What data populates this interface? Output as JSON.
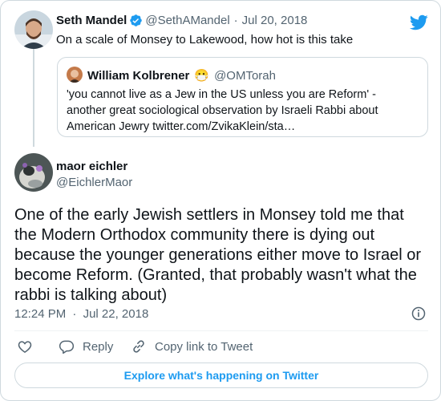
{
  "reply_to": {
    "display_name": "Seth Mandel",
    "handle": "@SethAMandel",
    "separator": "·",
    "date": "Jul 20, 2018",
    "text": "On a scale of Monsey to Lakewood, how hot is this take",
    "verified": true
  },
  "quoted": {
    "display_name": "William Kolbrener",
    "name_emoji": "😷",
    "handle": "@OMTorah",
    "text_lines": [
      "'you cannot live as a Jew in the US unless you are Reform' -",
      "another great sociological observation by Israeli Rabbi about",
      "American Jewry twitter.com/ZvikaKlein/sta…"
    ]
  },
  "tweet": {
    "display_name": "maor eichler",
    "handle": "@EichlerMaor",
    "text": "One of the early Jewish settlers in Monsey told me that the Modern Orthodox community there is dying out because the younger generations either move to Israel or become Reform. (Granted, that probably wasn't what the rabbi is talking about)",
    "time": "12:24 PM",
    "separator": "·",
    "date": "Jul 22, 2018"
  },
  "actions": {
    "reply_label": "Reply",
    "copy_label": "Copy link to Tweet"
  },
  "explore_label": "Explore what's happening on Twitter",
  "colors": {
    "accent": "#1d9bf0",
    "like_icon": "#536471",
    "border": "#cfd9de",
    "muted_text": "#536471"
  },
  "icons": [
    "twitter-bird-icon",
    "verified-badge-icon",
    "heart-icon",
    "reply-icon",
    "link-icon",
    "info-icon"
  ]
}
